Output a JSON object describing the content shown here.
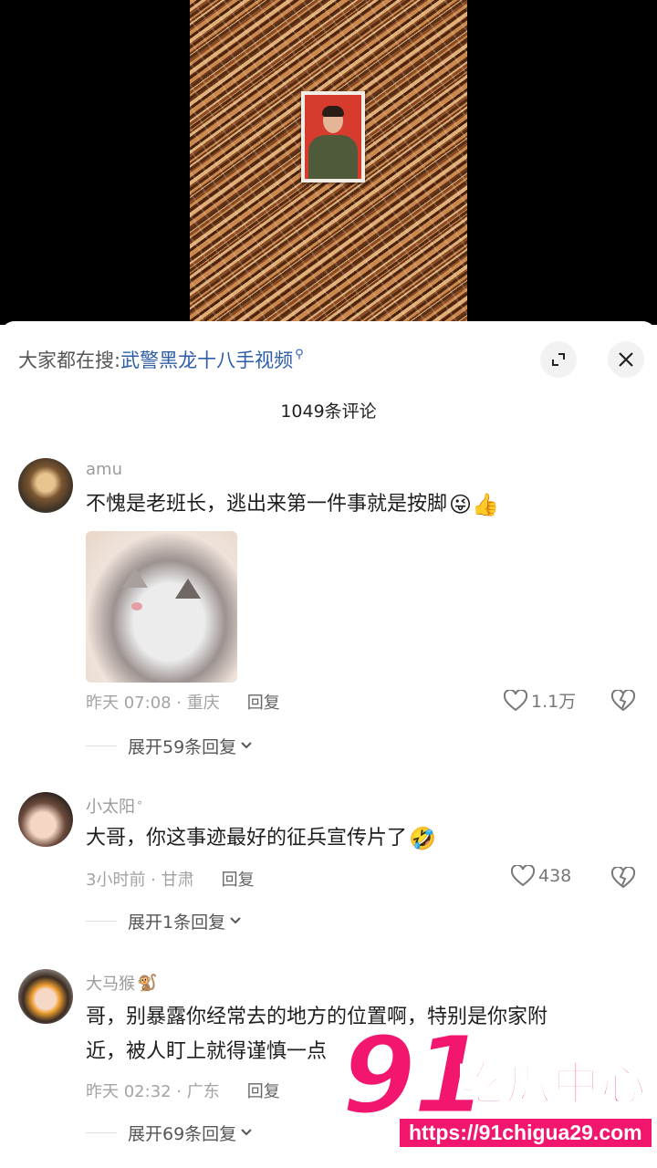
{
  "search": {
    "prefix": "大家都在搜:",
    "term": "武警黑龙十八手视频"
  },
  "comment_count": "1049条评论",
  "comments": [
    {
      "username": "amu",
      "text": "不愧是老班长，逃出来第一件事就是按脚",
      "emoji": "😜👍",
      "has_image": true,
      "time_location": "昨天 07:08 · 重庆",
      "reply": "回复",
      "likes": "1.1万",
      "expand": "展开59条回复"
    },
    {
      "username": "小太阳",
      "text": "大哥，你这事迹最好的征兵宣传片了",
      "emoji": "🤣",
      "time_location": "3小时前 · 甘肃",
      "reply": "回复",
      "likes": "438",
      "expand": "展开1条回复"
    },
    {
      "username": "大马猴",
      "badge": "🐒",
      "text_line1": "哥，别暴露你经常去的地方的位置啊，特别是你家附",
      "text_line2": "近，被人盯上就得谨慎一点",
      "time_location": "昨天 02:32 · 广东",
      "reply": "回复",
      "expand": "展开69条回复"
    }
  ],
  "watermark": {
    "number": "91",
    "name": "吃瓜中心",
    "url": "https://91chigua29.com"
  },
  "colors": {
    "accent_link": "#2f5ea8",
    "watermark": "#f2166e"
  }
}
